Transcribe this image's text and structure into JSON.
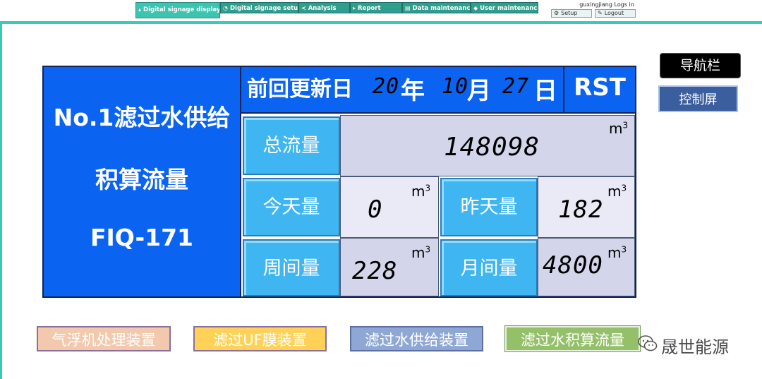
{
  "topnav": {
    "tabs": [
      {
        "label": "Digital signage display",
        "icon": "display-icon"
      },
      {
        "label": "Digital signage setup",
        "icon": "setup-icon"
      },
      {
        "label": "Analysis",
        "icon": "analysis-icon"
      },
      {
        "label": "Report",
        "icon": "report-icon"
      },
      {
        "label": "Data maintenance",
        "icon": "data-icon"
      },
      {
        "label": "User maintenance",
        "icon": "user-icon"
      }
    ],
    "login_text": "guxingjiang Logs in",
    "setup_label": "Setup",
    "logout_label": "Logout",
    "accent_color": "#38c9b8"
  },
  "title": {
    "line1": "No.1滤过水供给",
    "line2": "积算流量",
    "line3": "FIQ-171"
  },
  "header": {
    "label": "前回更新日",
    "year": "20",
    "year_unit": "年",
    "month": "10",
    "month_unit": "月",
    "day": "27",
    "day_unit": "日",
    "rst": "RST"
  },
  "total": {
    "label": "总流量",
    "value": "148098",
    "unit": "m"
  },
  "today": {
    "label": "今天量",
    "value": "0",
    "unit": "m"
  },
  "yesterday": {
    "label": "昨天量",
    "value": "182",
    "unit": "m"
  },
  "week": {
    "label": "周间量",
    "value": "228",
    "unit": "m"
  },
  "month": {
    "label": "月间量",
    "value": "4800",
    "unit": "m"
  },
  "unit_sup": "3",
  "side": {
    "nav_label": "导航栏",
    "control_label": "控制屏"
  },
  "bottom": {
    "btn1": "气浮机处理装置",
    "btn2": "滤过UF膜装置",
    "btn3": "滤过水供给装置",
    "btn4": "滤过水积算流量"
  },
  "watermark": "晟世能源"
}
